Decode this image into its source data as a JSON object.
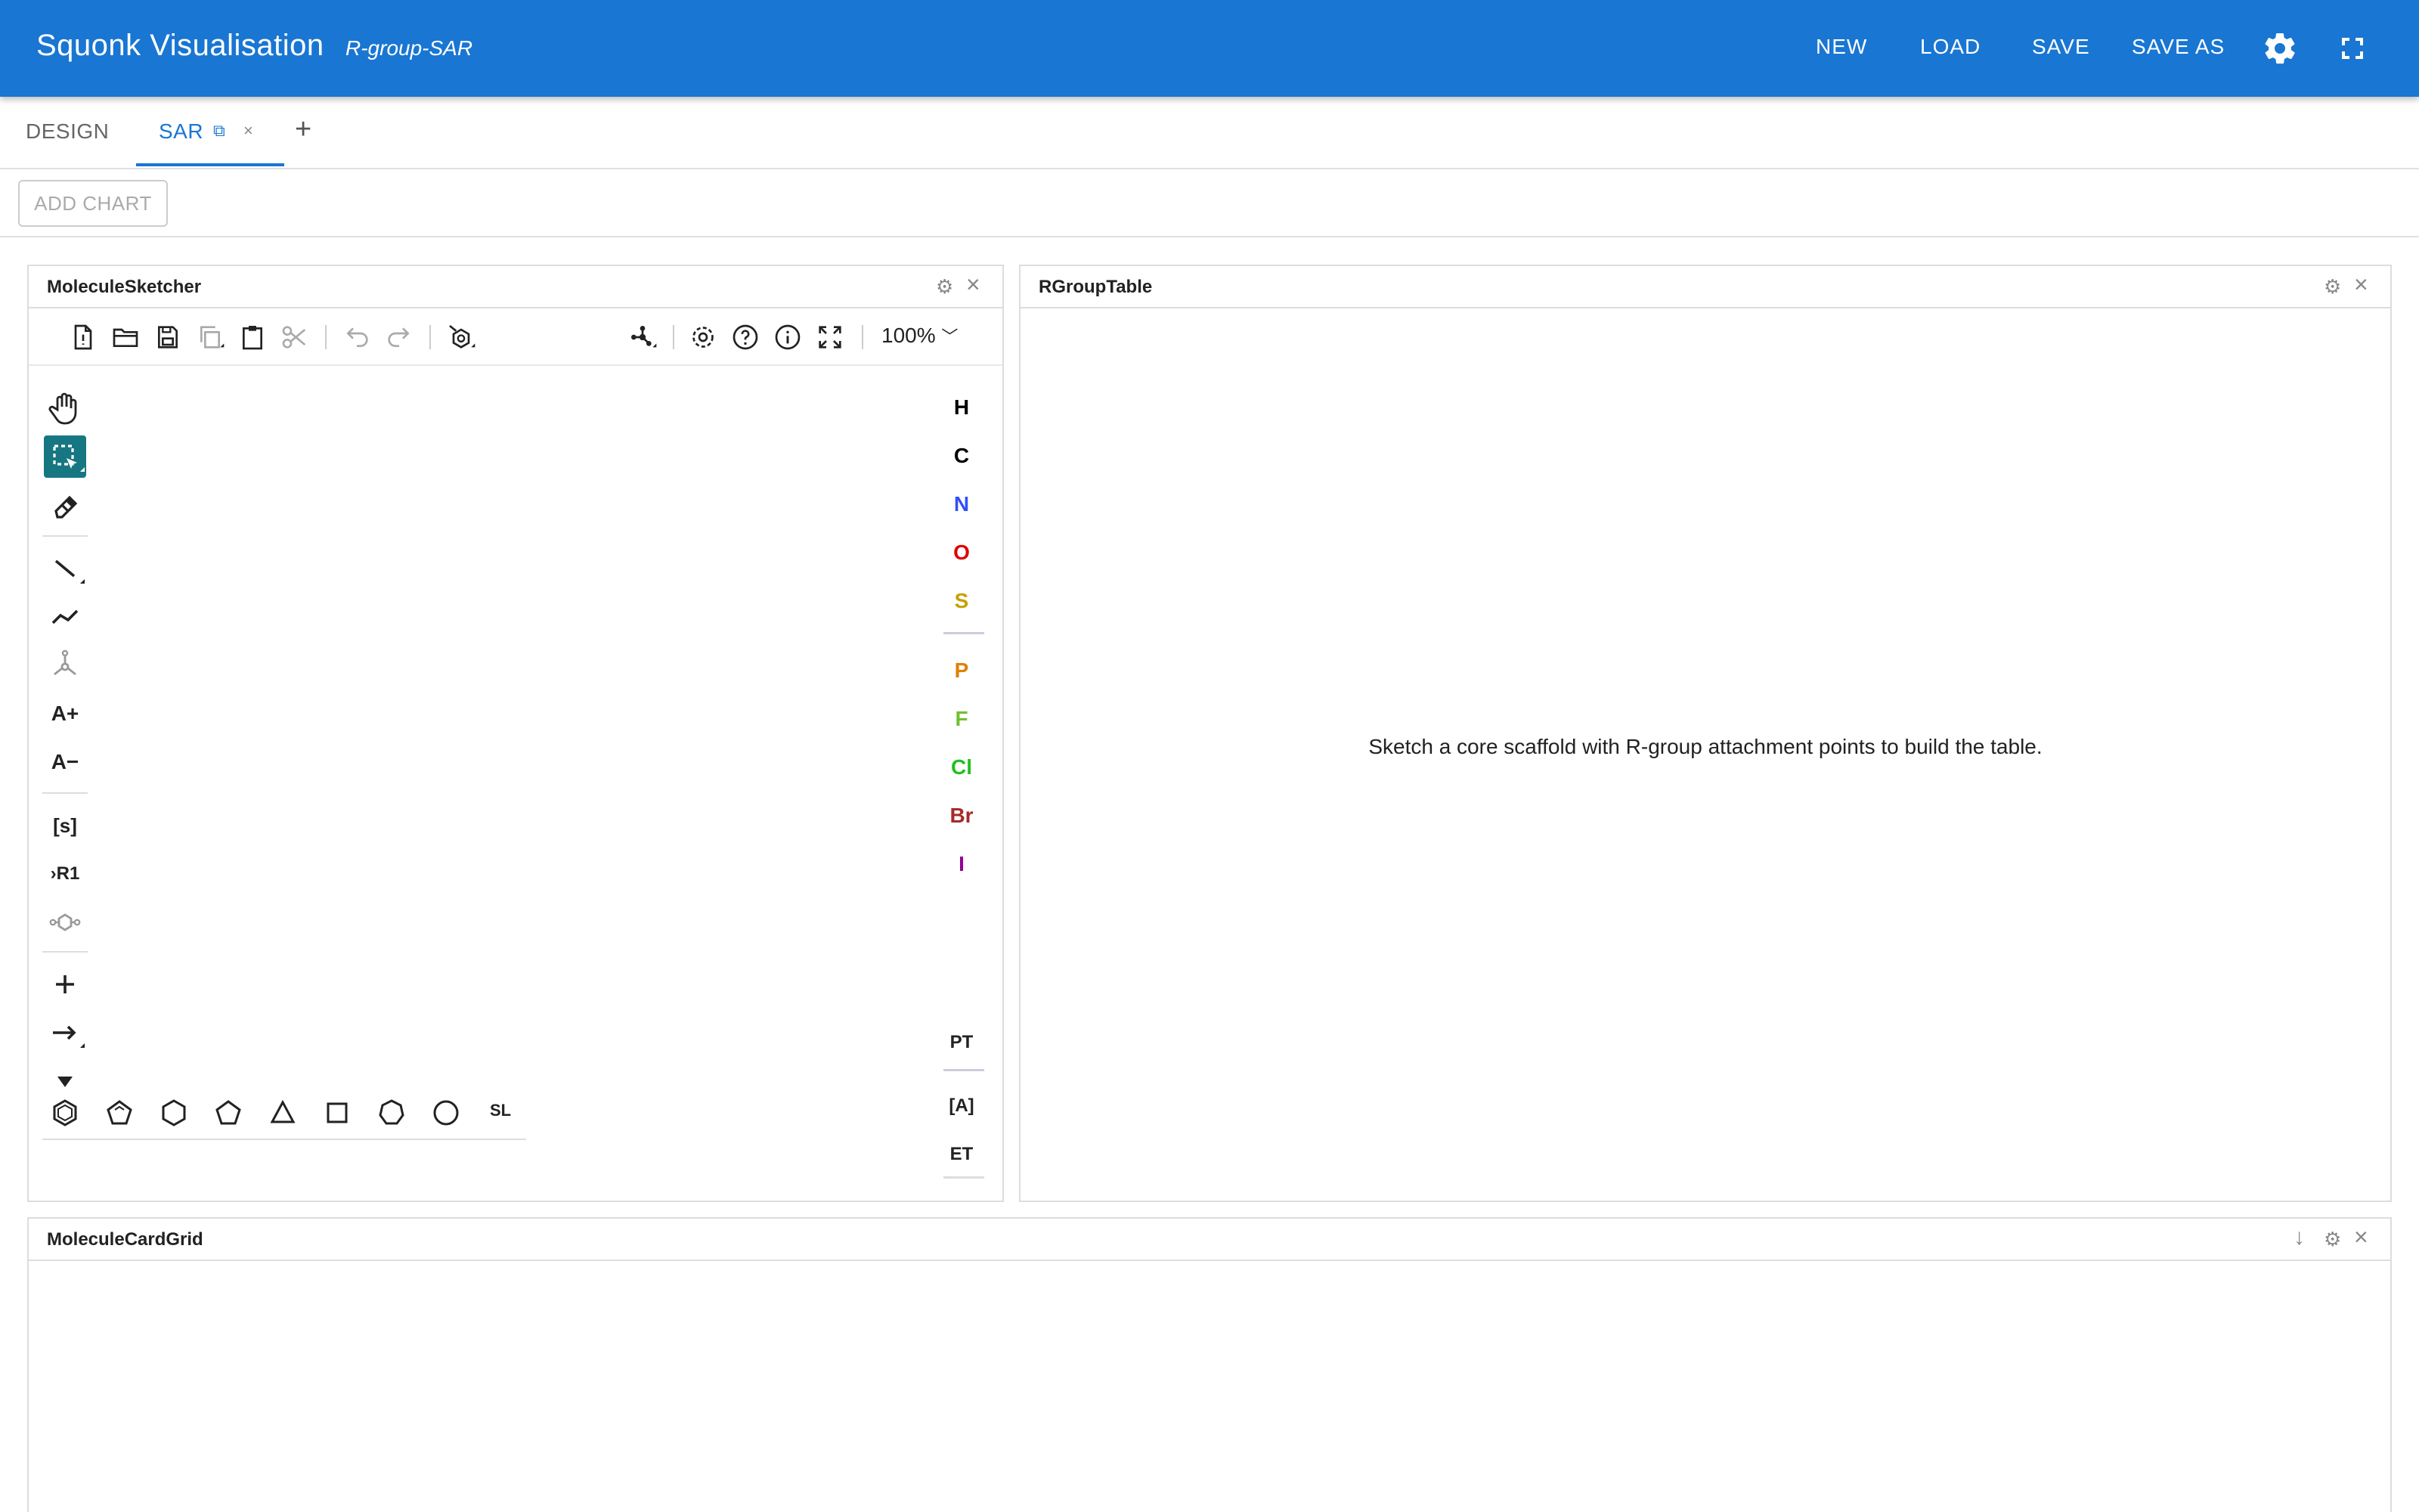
{
  "app": {
    "title": "Squonk Visualisation",
    "subtitle": "R-group-SAR",
    "buttons": {
      "new": "NEW",
      "load": "LOAD",
      "save": "SAVE",
      "save_as": "SAVE AS"
    },
    "icons": [
      "gear-icon",
      "fullscreen-icon"
    ],
    "brand_color": "#1976d2"
  },
  "tabs": {
    "design": "DESIGN",
    "sar": "SAR",
    "sar_copy_icon": "⧉",
    "sar_close_icon": "×",
    "add": "+"
  },
  "toolbar": {
    "add_chart": "ADD CHART"
  },
  "sketcher": {
    "title": "MoleculeSketcher",
    "zoom": "100%",
    "left_text_tools": {
      "add_charge": "A+",
      "remove_charge": "A−",
      "sgroup": "[s]",
      "rgroup": "›R1"
    },
    "atoms": [
      {
        "symbol": "H",
        "color": "#000000"
      },
      {
        "symbol": "C",
        "color": "#000000"
      },
      {
        "symbol": "N",
        "color": "#3050f8"
      },
      {
        "symbol": "O",
        "color": "#e00000"
      },
      {
        "symbol": "S",
        "color": "#c6a000"
      },
      {
        "symbol": "P",
        "color": "#e08000"
      },
      {
        "symbol": "F",
        "color": "#70c030"
      },
      {
        "symbol": "Cl",
        "color": "#1fc01f"
      },
      {
        "symbol": "Br",
        "color": "#a62929"
      },
      {
        "symbol": "I",
        "color": "#940094"
      }
    ],
    "atom_extra": {
      "periodic_table": "PT",
      "any_atom": "[A]",
      "extended_table": "ET"
    },
    "templates_library": "SL"
  },
  "rgroup": {
    "title": "RGroupTable",
    "message": "Sketch a core scaffold with R-group attachment points to build the table."
  },
  "cardgrid": {
    "title": "MoleculeCardGrid",
    "download_icon": "↓"
  },
  "panel_controls": {
    "settings": "⚙",
    "close": "×"
  }
}
